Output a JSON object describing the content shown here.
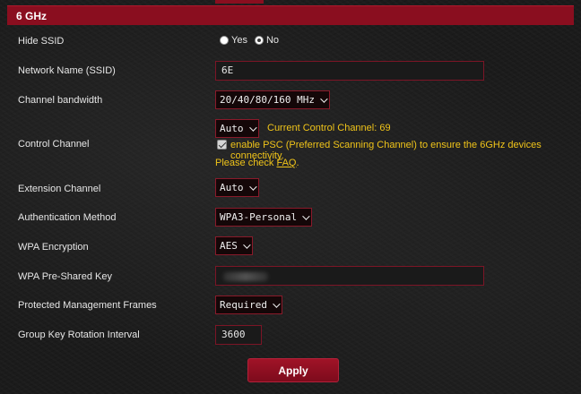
{
  "section": {
    "title": "6 GHz"
  },
  "hide_ssid": {
    "label": "Hide SSID",
    "options": [
      "Yes",
      "No"
    ],
    "selected": "No"
  },
  "ssid": {
    "label": "Network Name (SSID)",
    "value": "6E"
  },
  "bandwidth": {
    "label": "Channel bandwidth",
    "value": "20/40/80/160 MHz"
  },
  "control_channel": {
    "label": "Control Channel",
    "value": "Auto",
    "current_text": "Current Control Channel: 69",
    "psc_text": "enable PSC (Preferred Scanning Channel) to ensure the 6GHz devices connectivity.",
    "psc_checked": true,
    "check_prefix": "Please check ",
    "faq_link": "FAQ",
    "check_suffix": "."
  },
  "extension_channel": {
    "label": "Extension Channel",
    "value": "Auto"
  },
  "auth_method": {
    "label": "Authentication Method",
    "value": "WPA3-Personal"
  },
  "wpa_encryption": {
    "label": "WPA Encryption",
    "value": "AES"
  },
  "psk": {
    "label": "WPA Pre-Shared Key"
  },
  "pmf": {
    "label": "Protected Management Frames",
    "value": "Required"
  },
  "group_key": {
    "label": "Group Key Rotation Interval",
    "value": "3600"
  },
  "apply": {
    "label": "Apply"
  },
  "colors": {
    "accent": "#8a0e1f",
    "highlight_text": "#f0c419",
    "background": "#1b1b1b"
  }
}
